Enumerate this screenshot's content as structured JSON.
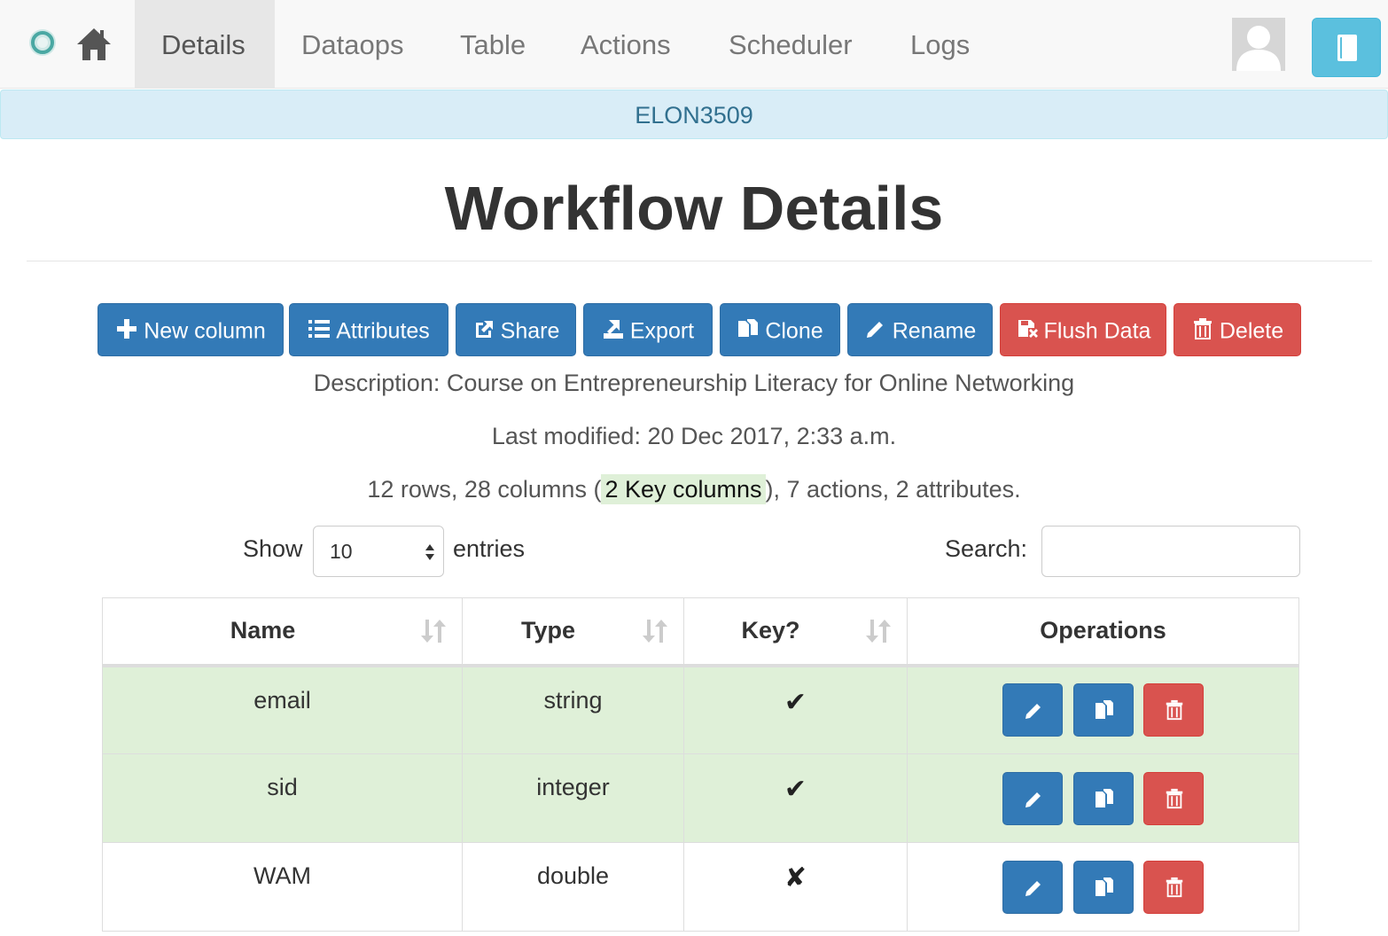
{
  "nav": {
    "items": [
      {
        "label": "Details",
        "active": true
      },
      {
        "label": "Dataops",
        "active": false
      },
      {
        "label": "Table",
        "active": false
      },
      {
        "label": "Actions",
        "active": false
      },
      {
        "label": "Scheduler",
        "active": false
      },
      {
        "label": "Logs",
        "active": false
      }
    ],
    "icons": [
      "logo-icon",
      "home-icon",
      "avatar-icon",
      "book-icon"
    ]
  },
  "workflow": {
    "name": "ELON3509"
  },
  "page": {
    "title": "Workflow Details"
  },
  "toolbar": {
    "new_column": "New column",
    "attributes": "Attributes",
    "share": "Share",
    "export": "Export",
    "clone": "Clone",
    "rename": "Rename",
    "flush_data": "Flush Data",
    "delete": "Delete"
  },
  "info": {
    "description": "Description: Course on Entrepreneurship Literacy for Online Networking",
    "last_modified": "Last modified: 20 Dec 2017, 2:33 a.m.",
    "counts_prefix": "12 rows, 28 columns (",
    "key_columns": "2 Key columns",
    "counts_suffix": "), 7 actions, 2 attributes."
  },
  "datatable": {
    "show_label": "Show",
    "page_length": "10",
    "entries_label": "entries",
    "search_label": "Search:",
    "search_value": "",
    "columns": [
      "Name",
      "Type",
      "Key?",
      "Operations"
    ],
    "rows": [
      {
        "name": "email",
        "type": "string",
        "key": "✔",
        "is_key": true
      },
      {
        "name": "sid",
        "type": "integer",
        "key": "✔",
        "is_key": true
      },
      {
        "name": "WAM",
        "type": "double",
        "key": "✘",
        "is_key": false
      }
    ]
  },
  "colors": {
    "primary": "#337ab7",
    "danger": "#d9534f",
    "info_bg": "#d9edf7",
    "info_text": "#31708f",
    "key_row_bg": "#dff0d8",
    "help_button": "#5bc0de"
  }
}
